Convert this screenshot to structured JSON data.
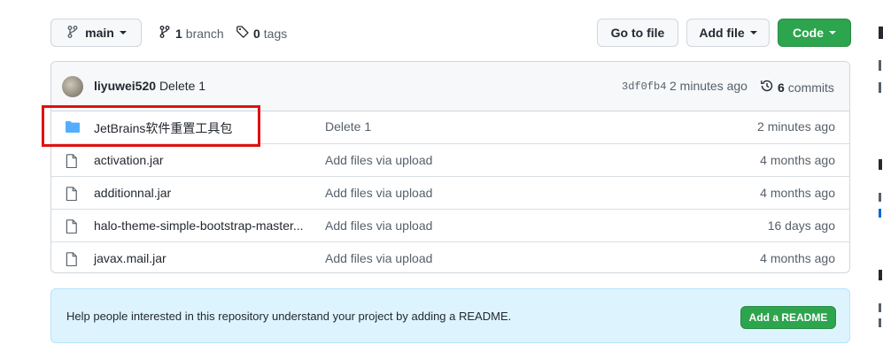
{
  "branch_select": {
    "label": "main"
  },
  "branches": {
    "count": "1",
    "label": "branch"
  },
  "tags": {
    "count": "0",
    "label": "tags"
  },
  "toolbar": {
    "go_to_file": "Go to file",
    "add_file": "Add file",
    "code": "Code"
  },
  "latest_commit": {
    "author": "liyuwei520",
    "message": "Delete 1",
    "sha": "3df0fb4",
    "time": "2 minutes ago",
    "commits_count": "6",
    "commits_label": "commits"
  },
  "files": [
    {
      "type": "folder",
      "name": "JetBrains软件重置工具包",
      "message": "Delete 1",
      "time": "2 minutes ago"
    },
    {
      "type": "file",
      "name": "activation.jar",
      "message": "Add files via upload",
      "time": "4 months ago"
    },
    {
      "type": "file",
      "name": "additionnal.jar",
      "message": "Add files via upload",
      "time": "4 months ago"
    },
    {
      "type": "file",
      "name": "halo-theme-simple-bootstrap-master...",
      "message": "Add files via upload",
      "time": "16 days ago"
    },
    {
      "type": "file",
      "name": "javax.mail.jar",
      "message": "Add files via upload",
      "time": "4 months ago"
    }
  ],
  "readme_banner": {
    "text": "Help people interested in this repository understand your project by adding a README.",
    "button": "Add a README"
  },
  "colors": {
    "primary_green": "#2da44e",
    "folder_blue": "#54aeff",
    "highlight_red": "#e01010",
    "banner_bg": "#ddf4ff"
  },
  "icons": [
    "branch-icon",
    "tag-icon",
    "history-icon",
    "folder-icon",
    "file-icon"
  ]
}
